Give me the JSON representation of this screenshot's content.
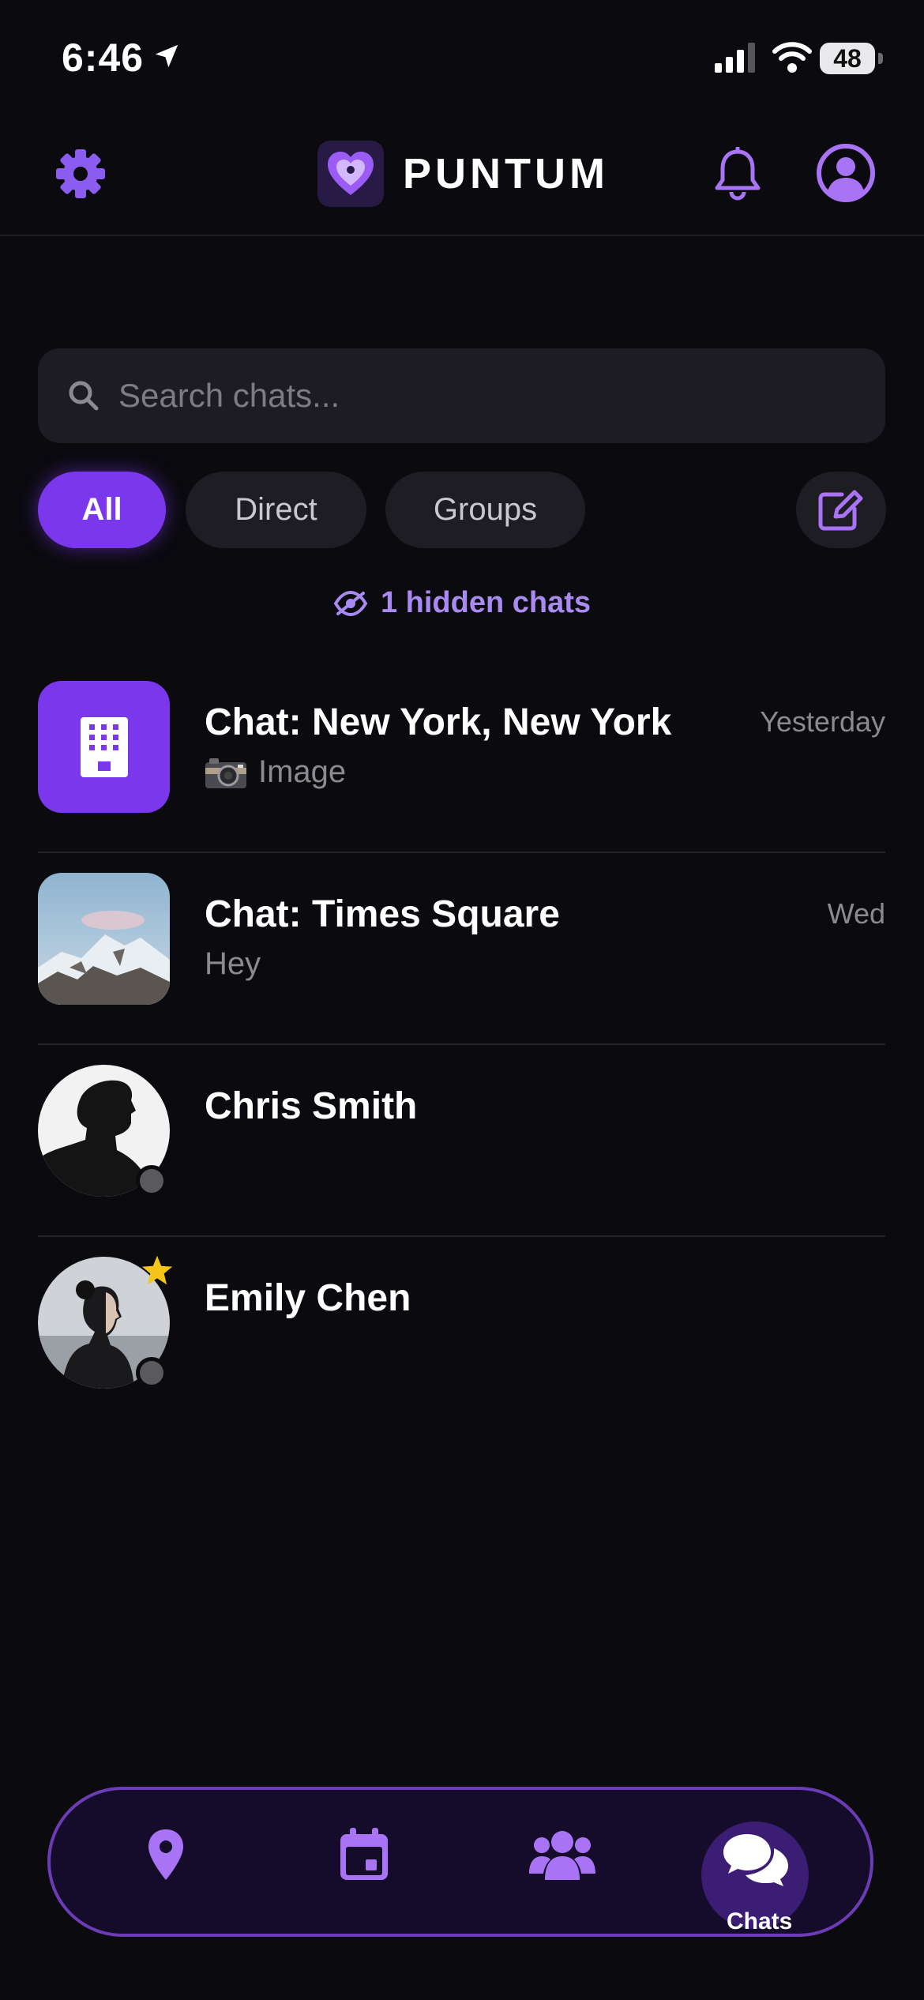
{
  "status_bar": {
    "time": "6:46",
    "battery": "48"
  },
  "header": {
    "brand": "PUNTUM"
  },
  "search": {
    "placeholder": "Search chats..."
  },
  "filters": {
    "all": "All",
    "direct": "Direct",
    "groups": "Groups"
  },
  "hidden_chats": "1 hidden chats",
  "chats": [
    {
      "name": "Chat: New York, New York",
      "preview": "Image",
      "preview_icon": "camera-icon",
      "time": "Yesterday",
      "avatar": "building-icon"
    },
    {
      "name": "Chat: Times Square",
      "preview": "Hey",
      "time": "Wed",
      "avatar": "mountain-photo"
    },
    {
      "name": "Chris Smith",
      "avatar": "silhouette-photo",
      "status": "offline"
    },
    {
      "name": "Emily Chen",
      "avatar": "portrait-photo",
      "status": "offline",
      "starred": true
    }
  ],
  "bottom_nav": {
    "active": "chats",
    "chats_label": "Chats"
  },
  "colors": {
    "accent": "#7a37ec",
    "accent_light": "#a88af0",
    "background": "#0b0a0f",
    "star": "#f5c518"
  }
}
